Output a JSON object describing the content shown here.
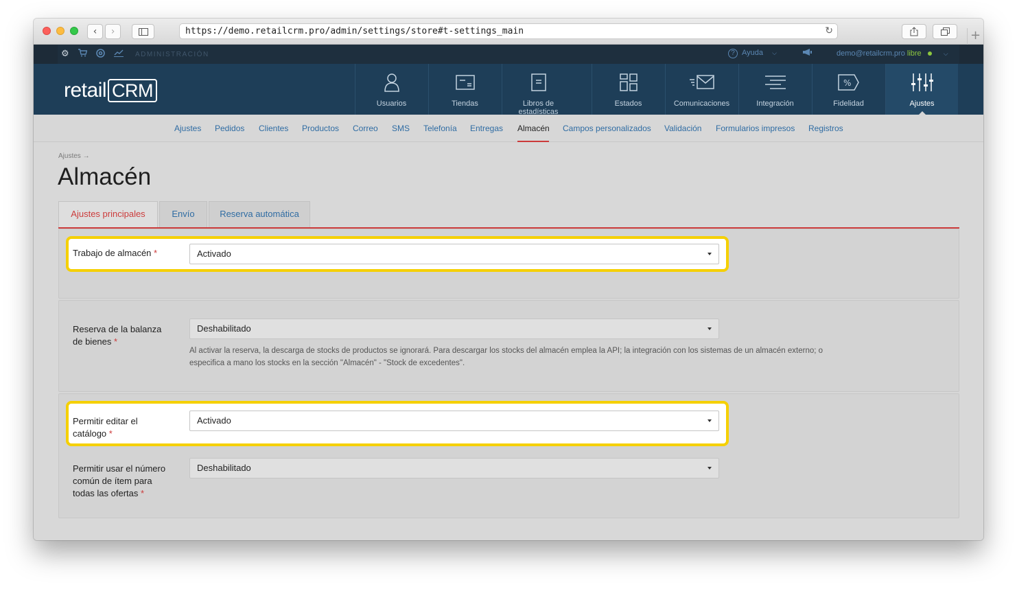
{
  "browser": {
    "url": "https://demo.retailcrm.pro/admin/settings/store#t-settings_main"
  },
  "adminbar": {
    "label": "ADMINISTRACIÓN",
    "help": "Ayuda",
    "user_email": "demo@retailcrm.pro",
    "user_plan": "libre"
  },
  "logo": {
    "text": "retail",
    "crm": "CRM"
  },
  "mainnav": [
    {
      "label": "Usuarios",
      "icon": "user-icon"
    },
    {
      "label": "Tiendas",
      "icon": "store-icon"
    },
    {
      "label": "Libros de estadísticas",
      "icon": "document-icon"
    },
    {
      "label": "Estados",
      "icon": "grid-icon"
    },
    {
      "label": "Comunicaciones",
      "icon": "mail-icon"
    },
    {
      "label": "Integración",
      "icon": "integration-icon"
    },
    {
      "label": "Fidelidad",
      "icon": "percent-tag-icon"
    },
    {
      "label": "Ajustes",
      "icon": "sliders-icon"
    }
  ],
  "subnav": [
    "Ajustes",
    "Pedidos",
    "Clientes",
    "Productos",
    "Correo",
    "SMS",
    "Telefonía",
    "Entregas",
    "Almacén",
    "Campos personalizados",
    "Validación",
    "Formularios impresos",
    "Registros"
  ],
  "breadcrumb": "Ajustes →",
  "page_title": "Almacén",
  "tabs": [
    "Ajustes principales",
    "Envío",
    "Reserva automática"
  ],
  "fields": {
    "warehouse_work": {
      "label": "Trabajo de almacén",
      "value": "Activado"
    },
    "reserve": {
      "label_line1": "Reserva de la balanza",
      "label_line2": "de bienes",
      "value": "Deshabilitado",
      "help_line1": "Al activar la reserva, la descarga de stocks de productos se ignorará. Para descargar los stocks del almacén emplea la API; la integración con los sistemas de un almacén externo; o",
      "help_line2": "especifica a mano los stocks en la sección \"Almacén\" - \"Stock de excedentes\"."
    },
    "edit_catalog": {
      "label_line1": "Permitir editar el",
      "label_line2": "catálogo",
      "value": "Activado"
    },
    "common_number": {
      "label_line1": "Permitir usar el número",
      "label_line2": "común de ítem para",
      "label_line3": "todas las ofertas",
      "value": "Deshabilitado"
    }
  },
  "required_mark": "*",
  "colors": {
    "accent_red": "#cc3b3b",
    "highlight_yellow": "#f5d000",
    "nav_dark": "#1e3e58",
    "link_blue": "#2f6ca3"
  }
}
